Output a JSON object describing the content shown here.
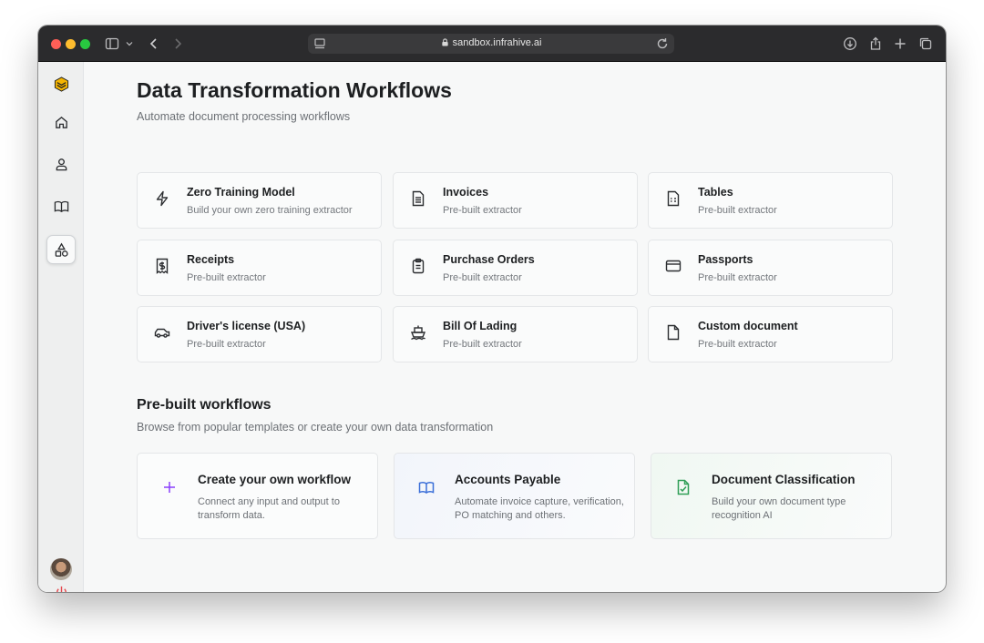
{
  "browser": {
    "url": "sandbox.infrahive.ai"
  },
  "page": {
    "title": "Data Transformation Workflows",
    "subtitle": "Automate document processing workflows"
  },
  "extractors": [
    {
      "title": "Zero Training Model",
      "desc": "Build your own zero training extractor",
      "icon": "lightning-icon"
    },
    {
      "title": "Invoices",
      "desc": "Pre-built extractor",
      "icon": "document-lines-icon"
    },
    {
      "title": "Tables",
      "desc": "Pre-built extractor",
      "icon": "table-document-icon"
    },
    {
      "title": "Receipts",
      "desc": "Pre-built extractor",
      "icon": "receipt-dollar-icon"
    },
    {
      "title": "Purchase Orders",
      "desc": "Pre-built extractor",
      "icon": "clipboard-list-icon"
    },
    {
      "title": "Passports",
      "desc": "Pre-built extractor",
      "icon": "card-icon"
    },
    {
      "title": "Driver's license (USA)",
      "desc": "Pre-built extractor",
      "icon": "car-icon"
    },
    {
      "title": "Bill Of Lading",
      "desc": "Pre-built extractor",
      "icon": "ship-icon"
    },
    {
      "title": "Custom document",
      "desc": "Pre-built extractor",
      "icon": "blank-document-icon"
    }
  ],
  "prebuilt": {
    "title": "Pre-built workflows",
    "subtitle": "Browse from popular templates or create your own data transformation",
    "items": [
      {
        "title": "Create your own workflow",
        "desc": "Connect any input and output to transform data.",
        "icon": "plus-icon",
        "color": "#8a3ffc"
      },
      {
        "title": "Accounts Payable",
        "desc": "Automate invoice capture, verification, PO matching and others.",
        "icon": "open-book-icon",
        "color": "#3b6fd8"
      },
      {
        "title": "Document Classification",
        "desc": "Build your own document type recognition AI",
        "icon": "document-check-icon",
        "color": "#2f9e56"
      }
    ]
  },
  "colors": {
    "logo": "#f4b400",
    "power": "#e5484d"
  }
}
